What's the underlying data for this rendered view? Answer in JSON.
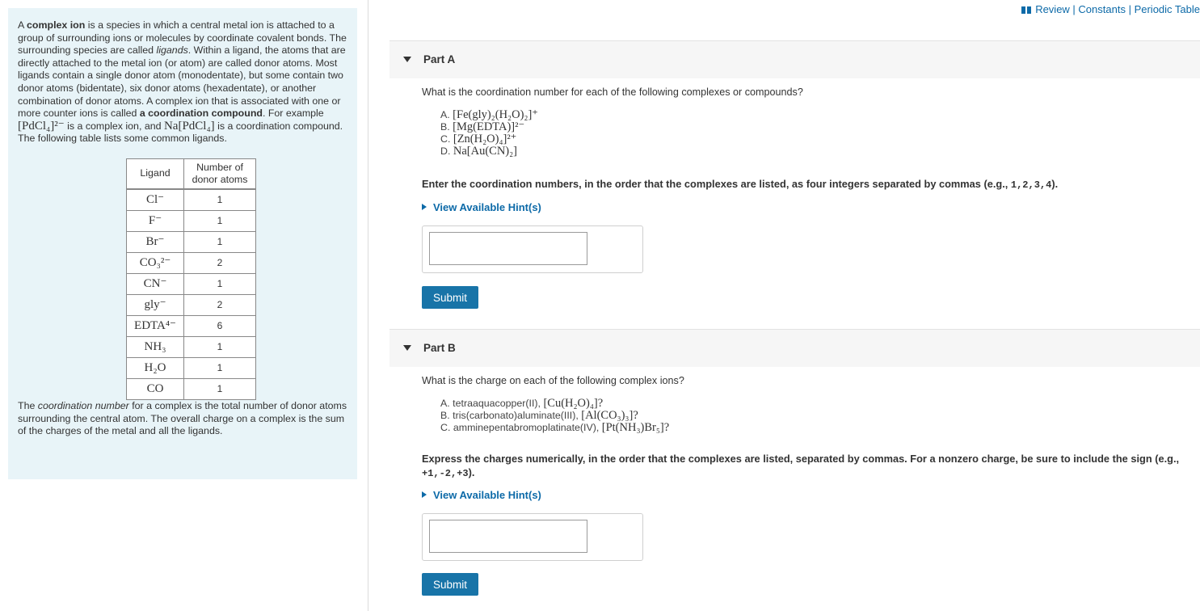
{
  "intro": {
    "p1_a": "A ",
    "term_complex_ion": "complex ion",
    "p1_b": " is a species in which a central metal ion is attached to a group of surrounding ions or molecules by coordinate covalent bonds. The surrounding species are called ",
    "term_ligands": "ligands",
    "p1_c": ". Within a ligand, the atoms that are directly attached to the metal ion (or atom) are called donor atoms. Most ligands contain a single donor atom (monodentate), but some contain two donor atoms (bidentate), six donor atoms (hexadentate), or another combination of donor atoms. A complex ion that is associated with one or more counter ions is called ",
    "term_coord_compound": "a coordination compound",
    "p1_d": ". For example ",
    "ex1": "[PdCl₄]²⁻",
    "p1_e": " is a complex ion, and ",
    "ex2": "Na[PdCl₄]",
    "p1_f": " is a coordination compound. The following table lists some common ligands.",
    "p2_a": "The ",
    "term_coord_number": "coordination number",
    "p2_b": " for a complex is the total number of donor atoms surrounding the central atom. The overall charge on a complex is the sum of the charges of the metal and all the ligands."
  },
  "ligand_table": {
    "headers": [
      "Ligand",
      "Number of donor atoms"
    ],
    "rows": [
      {
        "ligand": "Cl⁻",
        "donors": "1"
      },
      {
        "ligand": "F⁻",
        "donors": "1"
      },
      {
        "ligand": "Br⁻",
        "donors": "1"
      },
      {
        "ligand": "CO₃²⁻",
        "donors": "2"
      },
      {
        "ligand": "CN⁻",
        "donors": "1"
      },
      {
        "ligand": "gly⁻",
        "donors": "2"
      },
      {
        "ligand": "EDTA⁴⁻",
        "donors": "6"
      },
      {
        "ligand": "NH₃",
        "donors": "1"
      },
      {
        "ligand": "H₂O",
        "donors": "1"
      },
      {
        "ligand": "CO",
        "donors": "1"
      }
    ]
  },
  "toplinks": {
    "review": "Review",
    "sep": " | ",
    "constants": "Constants",
    "periodic": "Periodic Table"
  },
  "partA": {
    "title": "Part A",
    "question": "What is the coordination number for each of the following complexes or compounds?",
    "options": [
      {
        "letter": "A.",
        "formula": "[Fe(gly)₂(H₂O)₂]⁺"
      },
      {
        "letter": "B.",
        "formula": "[Mg(EDTA)]²⁻"
      },
      {
        "letter": "C.",
        "formula": "[Zn(H₂O)₄]²⁺"
      },
      {
        "letter": "D.",
        "formula": "Na[Au(CN)₂]"
      }
    ],
    "instr_a": "Enter the coordination numbers, in the order that the complexes are listed, as four integers separated by commas (e.g., ",
    "instr_example": "1,2,3,4",
    "instr_b": ").",
    "hint": "View Available Hint(s)",
    "input_value": "",
    "submit": "Submit"
  },
  "partB": {
    "title": "Part B",
    "question": "What is the charge on each of the following complex ions?",
    "options": [
      {
        "letter": "A.",
        "name": "tetraaquacopper(II), ",
        "formula": "[Cu(H₂O)₄]?"
      },
      {
        "letter": "B.",
        "name": "tris(carbonato)aluminate(III), ",
        "formula": "[Al(CO₃)₃]?"
      },
      {
        "letter": "C.",
        "name": "amminepentabromoplatinate(IV), ",
        "formula": "[Pt(NH₃)Br₅]?"
      }
    ],
    "instr_a": "Express the charges numerically, in the order that the complexes are listed, separated by commas. For a nonzero charge, be sure to include the sign (e.g., ",
    "instr_example": "+1,-2,+3",
    "instr_b": ").",
    "hint": "View Available Hint(s)",
    "input_value": "",
    "submit": "Submit"
  }
}
